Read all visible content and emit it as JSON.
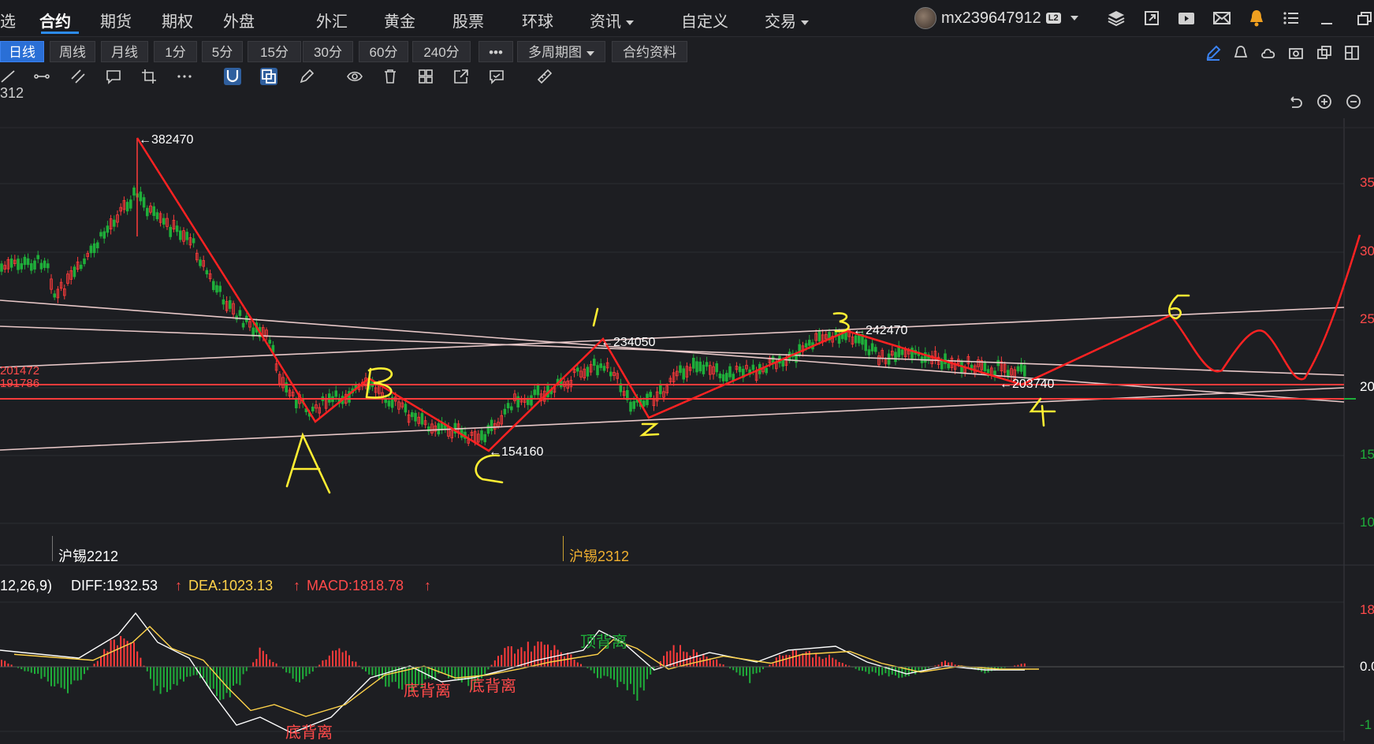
{
  "nav": {
    "partial_left": "选",
    "items": [
      {
        "label": "合约",
        "active": true
      },
      {
        "label": "期货"
      },
      {
        "label": "期权"
      },
      {
        "label": "外盘"
      },
      {
        "label": "外汇"
      },
      {
        "label": "黄金"
      },
      {
        "label": "股票"
      },
      {
        "label": "环球"
      },
      {
        "label": "资讯",
        "dropdown": true
      },
      {
        "label": "自定义"
      },
      {
        "label": "交易",
        "dropdown": true
      }
    ]
  },
  "user": {
    "name": "mx239647912",
    "badge": "L2"
  },
  "periods": {
    "buttons": [
      "日线",
      "周线",
      "月线",
      "1分",
      "5分",
      "15分",
      "30分",
      "60分",
      "240分",
      "•••",
      "多周期图",
      "合约资料"
    ],
    "selected": "日线"
  },
  "symbol_code": "312",
  "price_chart": {
    "annotations": {
      "high": "←382470",
      "p1": "←234050",
      "p3": "←242470",
      "p4": "←203740",
      "low": "←154160",
      "left1": "201472",
      "left2": "191786"
    },
    "contracts": [
      "沪锡2212",
      "沪锡2312"
    ],
    "axis_labels": [
      "35",
      "30",
      "25",
      "20",
      "15",
      "10"
    ],
    "wave_labels": [
      "A",
      "B",
      "C",
      "1",
      "2",
      "3",
      "4",
      "5"
    ]
  },
  "macd": {
    "params": "12,26,9)",
    "diff": "DIFF:1932.53",
    "dea": "DEA:1023.13",
    "macd": "MACD:1818.78",
    "axis_labels": [
      "18",
      "0.0",
      "-1"
    ],
    "divergence": [
      "顶背离",
      "底背离",
      "底背离",
      "底背离"
    ]
  },
  "colors": {
    "accent": "#2a6fd6",
    "up": "#ff3b3b",
    "down": "#1fae3a",
    "dea": "#ffd34a"
  }
}
